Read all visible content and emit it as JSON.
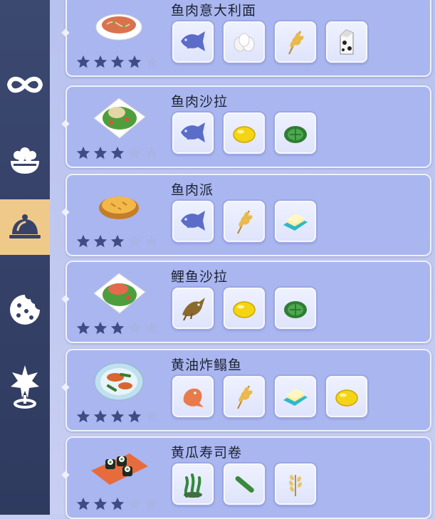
{
  "colors": {
    "sidebar_bg": "#36426a",
    "sidebar_active": "#efc98a",
    "card_bg": "#aab6ef",
    "star_filled": "#3f4d84",
    "star_empty": "#a8b3e6"
  },
  "sidebar": {
    "items": [
      {
        "icon": "infinity-icon",
        "active": false
      },
      {
        "icon": "food-bowl-icon",
        "active": false
      },
      {
        "icon": "cloche-icon",
        "active": true
      },
      {
        "icon": "cookie-icon",
        "active": false
      },
      {
        "icon": "star-burst-icon",
        "active": false
      }
    ]
  },
  "recipes": [
    {
      "name": "鱼肉意大利面",
      "dish_icon": "fish-pasta-dish",
      "rating": 4,
      "max_rating": 5,
      "ingredients": [
        "fish-icon",
        "eggs-icon",
        "wheat-icon",
        "milk-carton-icon"
      ]
    },
    {
      "name": "鱼肉沙拉",
      "dish_icon": "fish-salad-dish",
      "rating": 3,
      "max_rating": 5,
      "ingredients": [
        "fish-icon",
        "lemon-icon",
        "cabbage-icon"
      ]
    },
    {
      "name": "鱼肉派",
      "dish_icon": "fish-pie-dish",
      "rating": 3,
      "max_rating": 5,
      "ingredients": [
        "fish-icon",
        "wheat-icon",
        "butter-icon"
      ]
    },
    {
      "name": "鲤鱼沙拉",
      "dish_icon": "carp-salad-dish",
      "rating": 3,
      "max_rating": 5,
      "ingredients": [
        "carp-icon",
        "lemon-icon",
        "cabbage-icon"
      ]
    },
    {
      "name": "黄油炸鳎鱼",
      "dish_icon": "fried-sole-dish",
      "rating": 4,
      "max_rating": 5,
      "ingredients": [
        "sole-fish-icon",
        "wheat-icon",
        "butter-icon",
        "lemon-icon"
      ]
    },
    {
      "name": "黄瓜寿司卷",
      "dish_icon": "sushi-roll-dish",
      "rating": 3,
      "max_rating": 5,
      "ingredients": [
        "seaweed-icon",
        "cucumber-icon",
        "rice-icon"
      ]
    }
  ]
}
